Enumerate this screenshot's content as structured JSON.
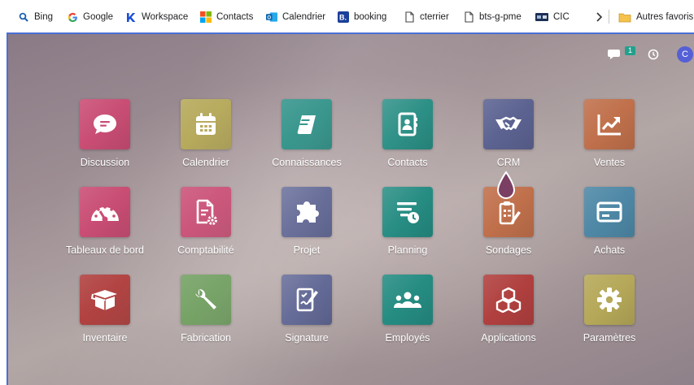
{
  "bookmarks": [
    {
      "label": "Bing",
      "icon": "bing-search-icon"
    },
    {
      "label": "Google",
      "icon": "google-icon"
    },
    {
      "label": "Workspace",
      "icon": "workspace-icon"
    },
    {
      "label": "Contacts",
      "icon": "contacts-icon"
    },
    {
      "label": "Calendrier",
      "icon": "outlook-calendar-icon"
    },
    {
      "label": "booking",
      "icon": "booking-icon"
    },
    {
      "label": "cterrier",
      "icon": "page-icon"
    },
    {
      "label": "bts-g-pme",
      "icon": "page-icon"
    },
    {
      "label": "CIC",
      "icon": "card-icon"
    }
  ],
  "other_favorites": {
    "label": "Autres favoris",
    "icon": "folder-icon"
  },
  "topbar": {
    "chat_badge": "1",
    "avatar_letter": "C"
  },
  "apps": [
    {
      "label": "Discussion",
      "icon": "chat-bubble-icon",
      "color": "#c94d74"
    },
    {
      "label": "Calendrier",
      "icon": "calendar-icon",
      "color": "#b5a859"
    },
    {
      "label": "Connaissances",
      "icon": "book-icon",
      "color": "#258c82"
    },
    {
      "label": "Contacts",
      "icon": "address-book-icon",
      "color": "#258c82"
    },
    {
      "label": "CRM",
      "icon": "handshake-icon",
      "color": "#5c6391"
    },
    {
      "label": "Ventes",
      "icon": "chart-up-icon",
      "color": "#c0704b"
    },
    {
      "label": "Tableaux de bord",
      "icon": "dashboard-gauge-icon",
      "color": "#c94d74"
    },
    {
      "label": "Comptabilité",
      "icon": "accounting-doc-icon",
      "color": "#c94d74"
    },
    {
      "label": "Projet",
      "icon": "puzzle-icon",
      "color": "#5c6391"
    },
    {
      "label": "Planning",
      "icon": "planning-icon",
      "color": "#258c82"
    },
    {
      "label": "Sondages",
      "icon": "survey-icon",
      "color": "#c0704b"
    },
    {
      "label": "Achats",
      "icon": "credit-card-icon",
      "color": "#4e88a6"
    },
    {
      "label": "Inventaire",
      "icon": "box-icon",
      "color": "#b0403f"
    },
    {
      "label": "Fabrication",
      "icon": "wrench-icon",
      "color": "#6b9b5a"
    },
    {
      "label": "Signature",
      "icon": "signature-icon",
      "color": "#5c6391"
    },
    {
      "label": "Employés",
      "icon": "employees-icon",
      "color": "#258c82"
    },
    {
      "label": "Applications",
      "icon": "cubes-icon",
      "color": "#b0403f"
    },
    {
      "label": "Paramètres",
      "icon": "gear-icon",
      "color": "#b5a859"
    }
  ]
}
